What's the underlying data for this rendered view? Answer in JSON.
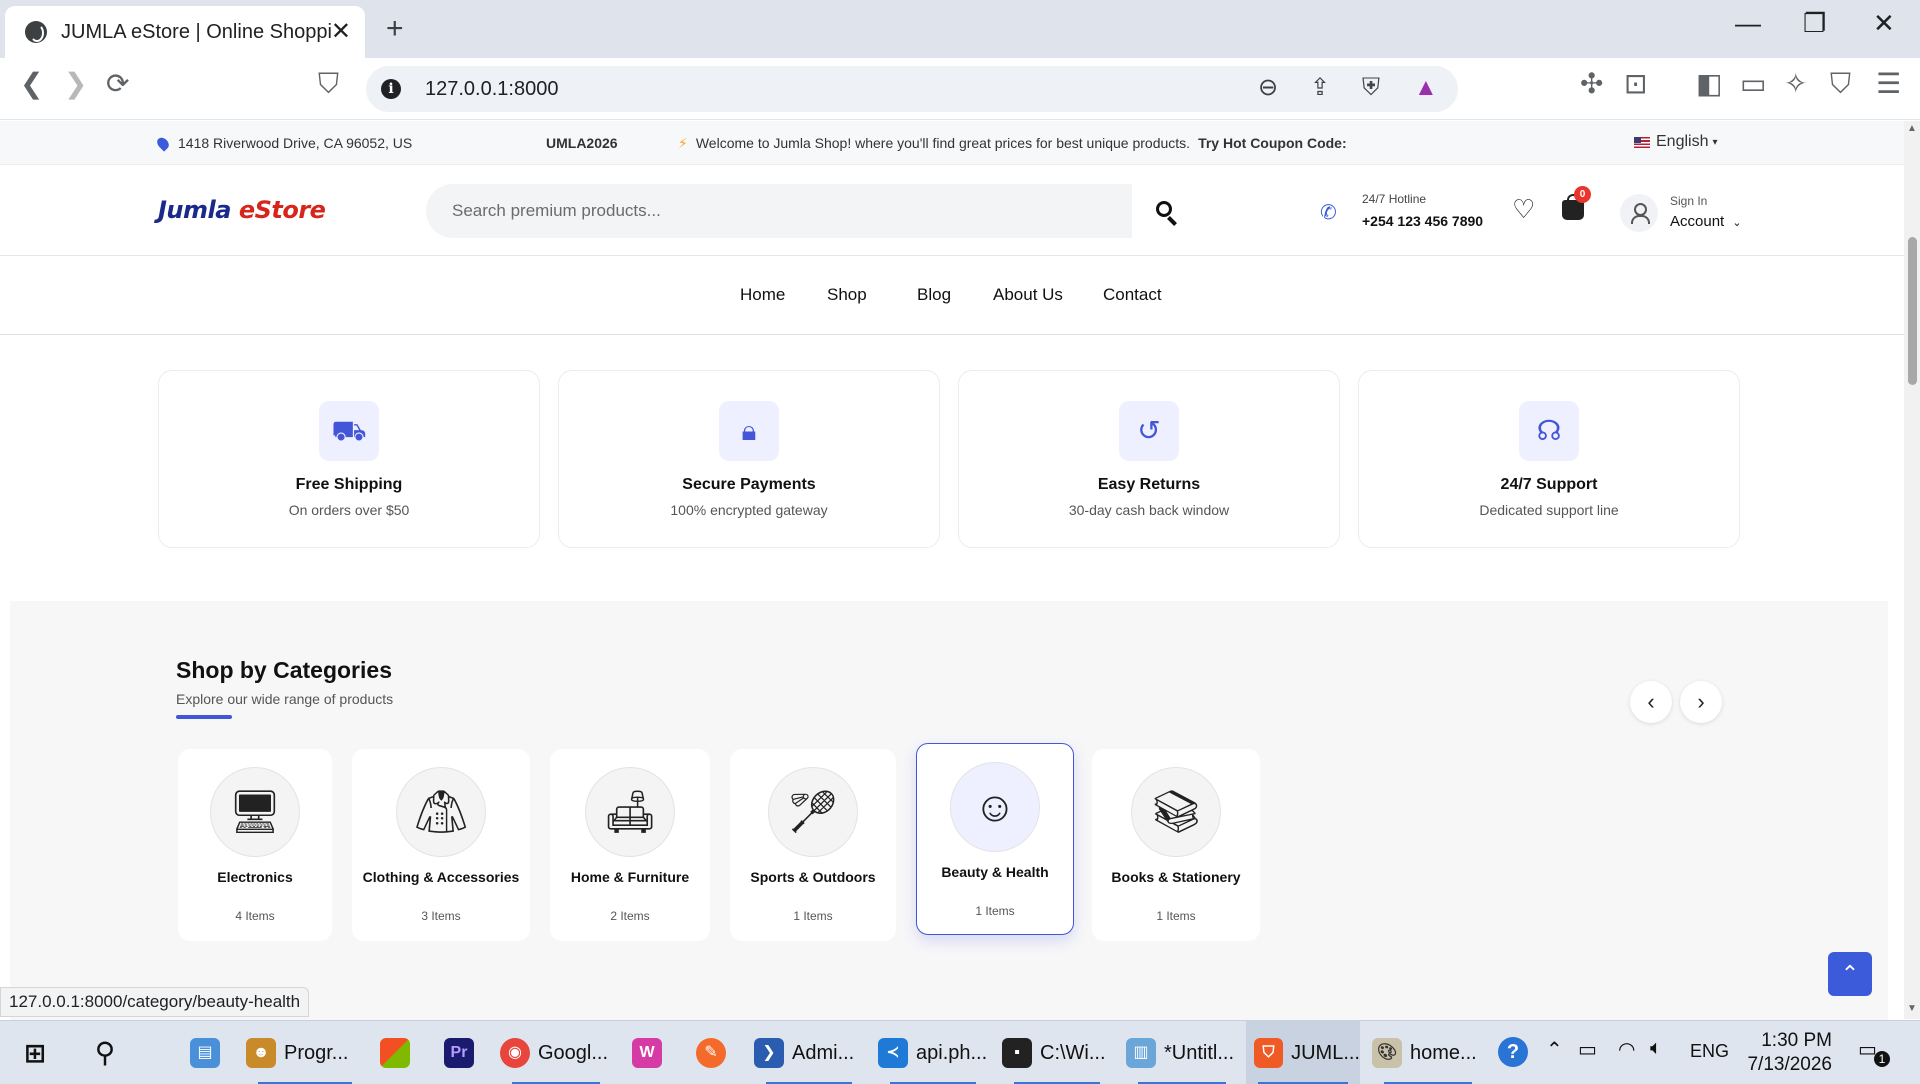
{
  "browser": {
    "tab_title": "JUMLA eStore | Online Shopping",
    "tab_close": "✕",
    "new_tab": "+",
    "url": "127.0.0.1:8000",
    "window_controls": {
      "minimize": "—",
      "maximize": "❐",
      "close": "✕"
    },
    "status_url": "127.0.0.1:8000/category/beauty-health"
  },
  "topbar": {
    "address": "1418 Riverwood Drive, CA 96052, US",
    "coupon_fragment": "UMLA2026",
    "welcome": "Welcome to Jumla Shop! where you'll find great prices for best unique products.",
    "coupon_prefix": "Try Hot Coupon Code: JU",
    "language": "English"
  },
  "header": {
    "logo_main": "Jumla",
    "logo_accent": "eStore",
    "search_placeholder": "Search premium products...",
    "hotline_label": "24/7 Hotline",
    "hotline_number": "+254 123 456 7890",
    "cart_count": "0",
    "signin_label": "Sign In",
    "account_label": "Account"
  },
  "nav": {
    "items": [
      "Home",
      "Shop",
      "Blog",
      "About Us",
      "Contact"
    ]
  },
  "features": [
    {
      "icon": "truck-icon",
      "title": "Free Shipping",
      "subtitle": "On orders over $50"
    },
    {
      "icon": "lock-icon",
      "title": "Secure Payments",
      "subtitle": "100% encrypted gateway"
    },
    {
      "icon": "return-icon",
      "title": "Easy Returns",
      "subtitle": "30-day cash back window"
    },
    {
      "icon": "headset-icon",
      "title": "24/7 Support",
      "subtitle": "Dedicated support line"
    }
  ],
  "categories": {
    "title": "Shop by Categories",
    "subtitle": "Explore our wide range of products",
    "items": [
      {
        "name": "Electronics",
        "count": "4 Items",
        "icon": "electronics-icon"
      },
      {
        "name": "Clothing & Accessories",
        "count": "3 Items",
        "icon": "jacket-icon"
      },
      {
        "name": "Home & Furniture",
        "count": "2 Items",
        "icon": "furniture-icon"
      },
      {
        "name": "Sports & Outdoors",
        "count": "1 Items",
        "icon": "sports-icon"
      },
      {
        "name": "Beauty & Health",
        "count": "1 Items",
        "icon": "face-icon"
      },
      {
        "name": "Books & Stationery",
        "count": "1 Items",
        "icon": "books-icon"
      }
    ]
  },
  "taskbar": {
    "apps": [
      "Progr...",
      "Googl...",
      "Admi...",
      "api.ph...",
      "C:\\Wi...",
      "*Untitl...",
      "JUML...",
      "home..."
    ],
    "language": "ENG",
    "time": "1:30 PM",
    "date": "7/13/2026",
    "notifications": "1"
  },
  "colors": {
    "accent": "#4456d8",
    "badge": "#e8362f",
    "logo_blue": "#1a2a8a",
    "logo_red": "#d6261c"
  }
}
